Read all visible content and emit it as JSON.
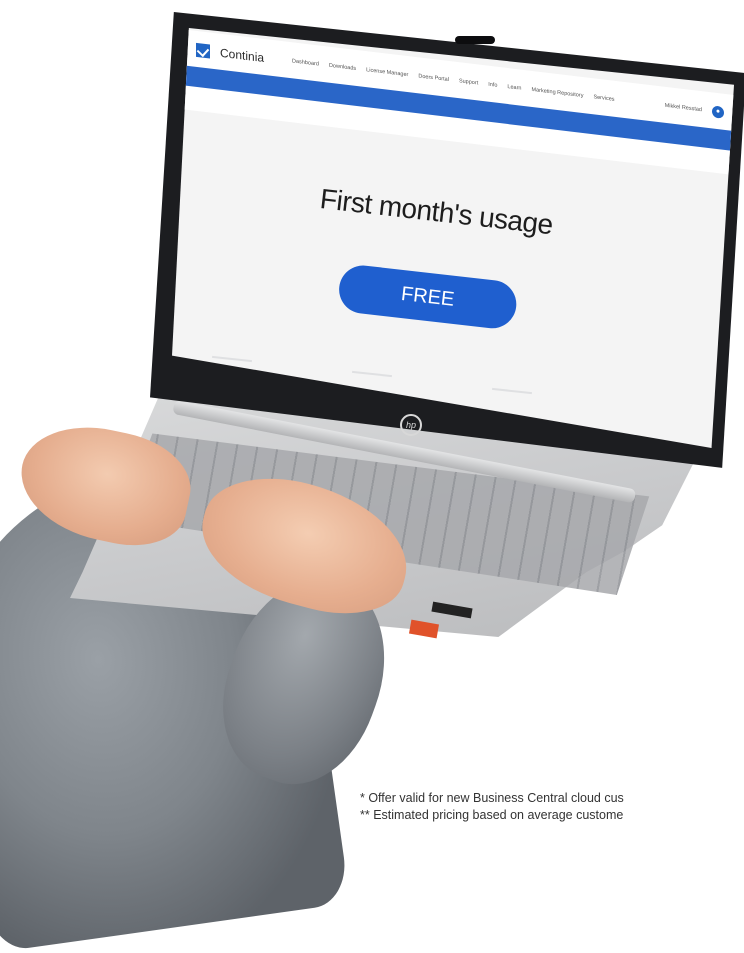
{
  "screen": {
    "logo_text": "Continia",
    "nav": [
      "Dashboard",
      "Downloads",
      "License Manager",
      "Doers Portal",
      "Support",
      "Info",
      "Learn",
      "Marketing Repository",
      "Services"
    ],
    "user_name": "Mikkel Resstad",
    "headline": "First month's usage",
    "cta_label": "FREE"
  },
  "laptop": {
    "brand_logo": "hp"
  },
  "footnotes": {
    "line1": "* Offer valid for new Business Central cloud cus",
    "line2": "** Estimated pricing based on average custome"
  },
  "colors": {
    "accent": "#1f5fcf",
    "band": "#2a66c8"
  }
}
